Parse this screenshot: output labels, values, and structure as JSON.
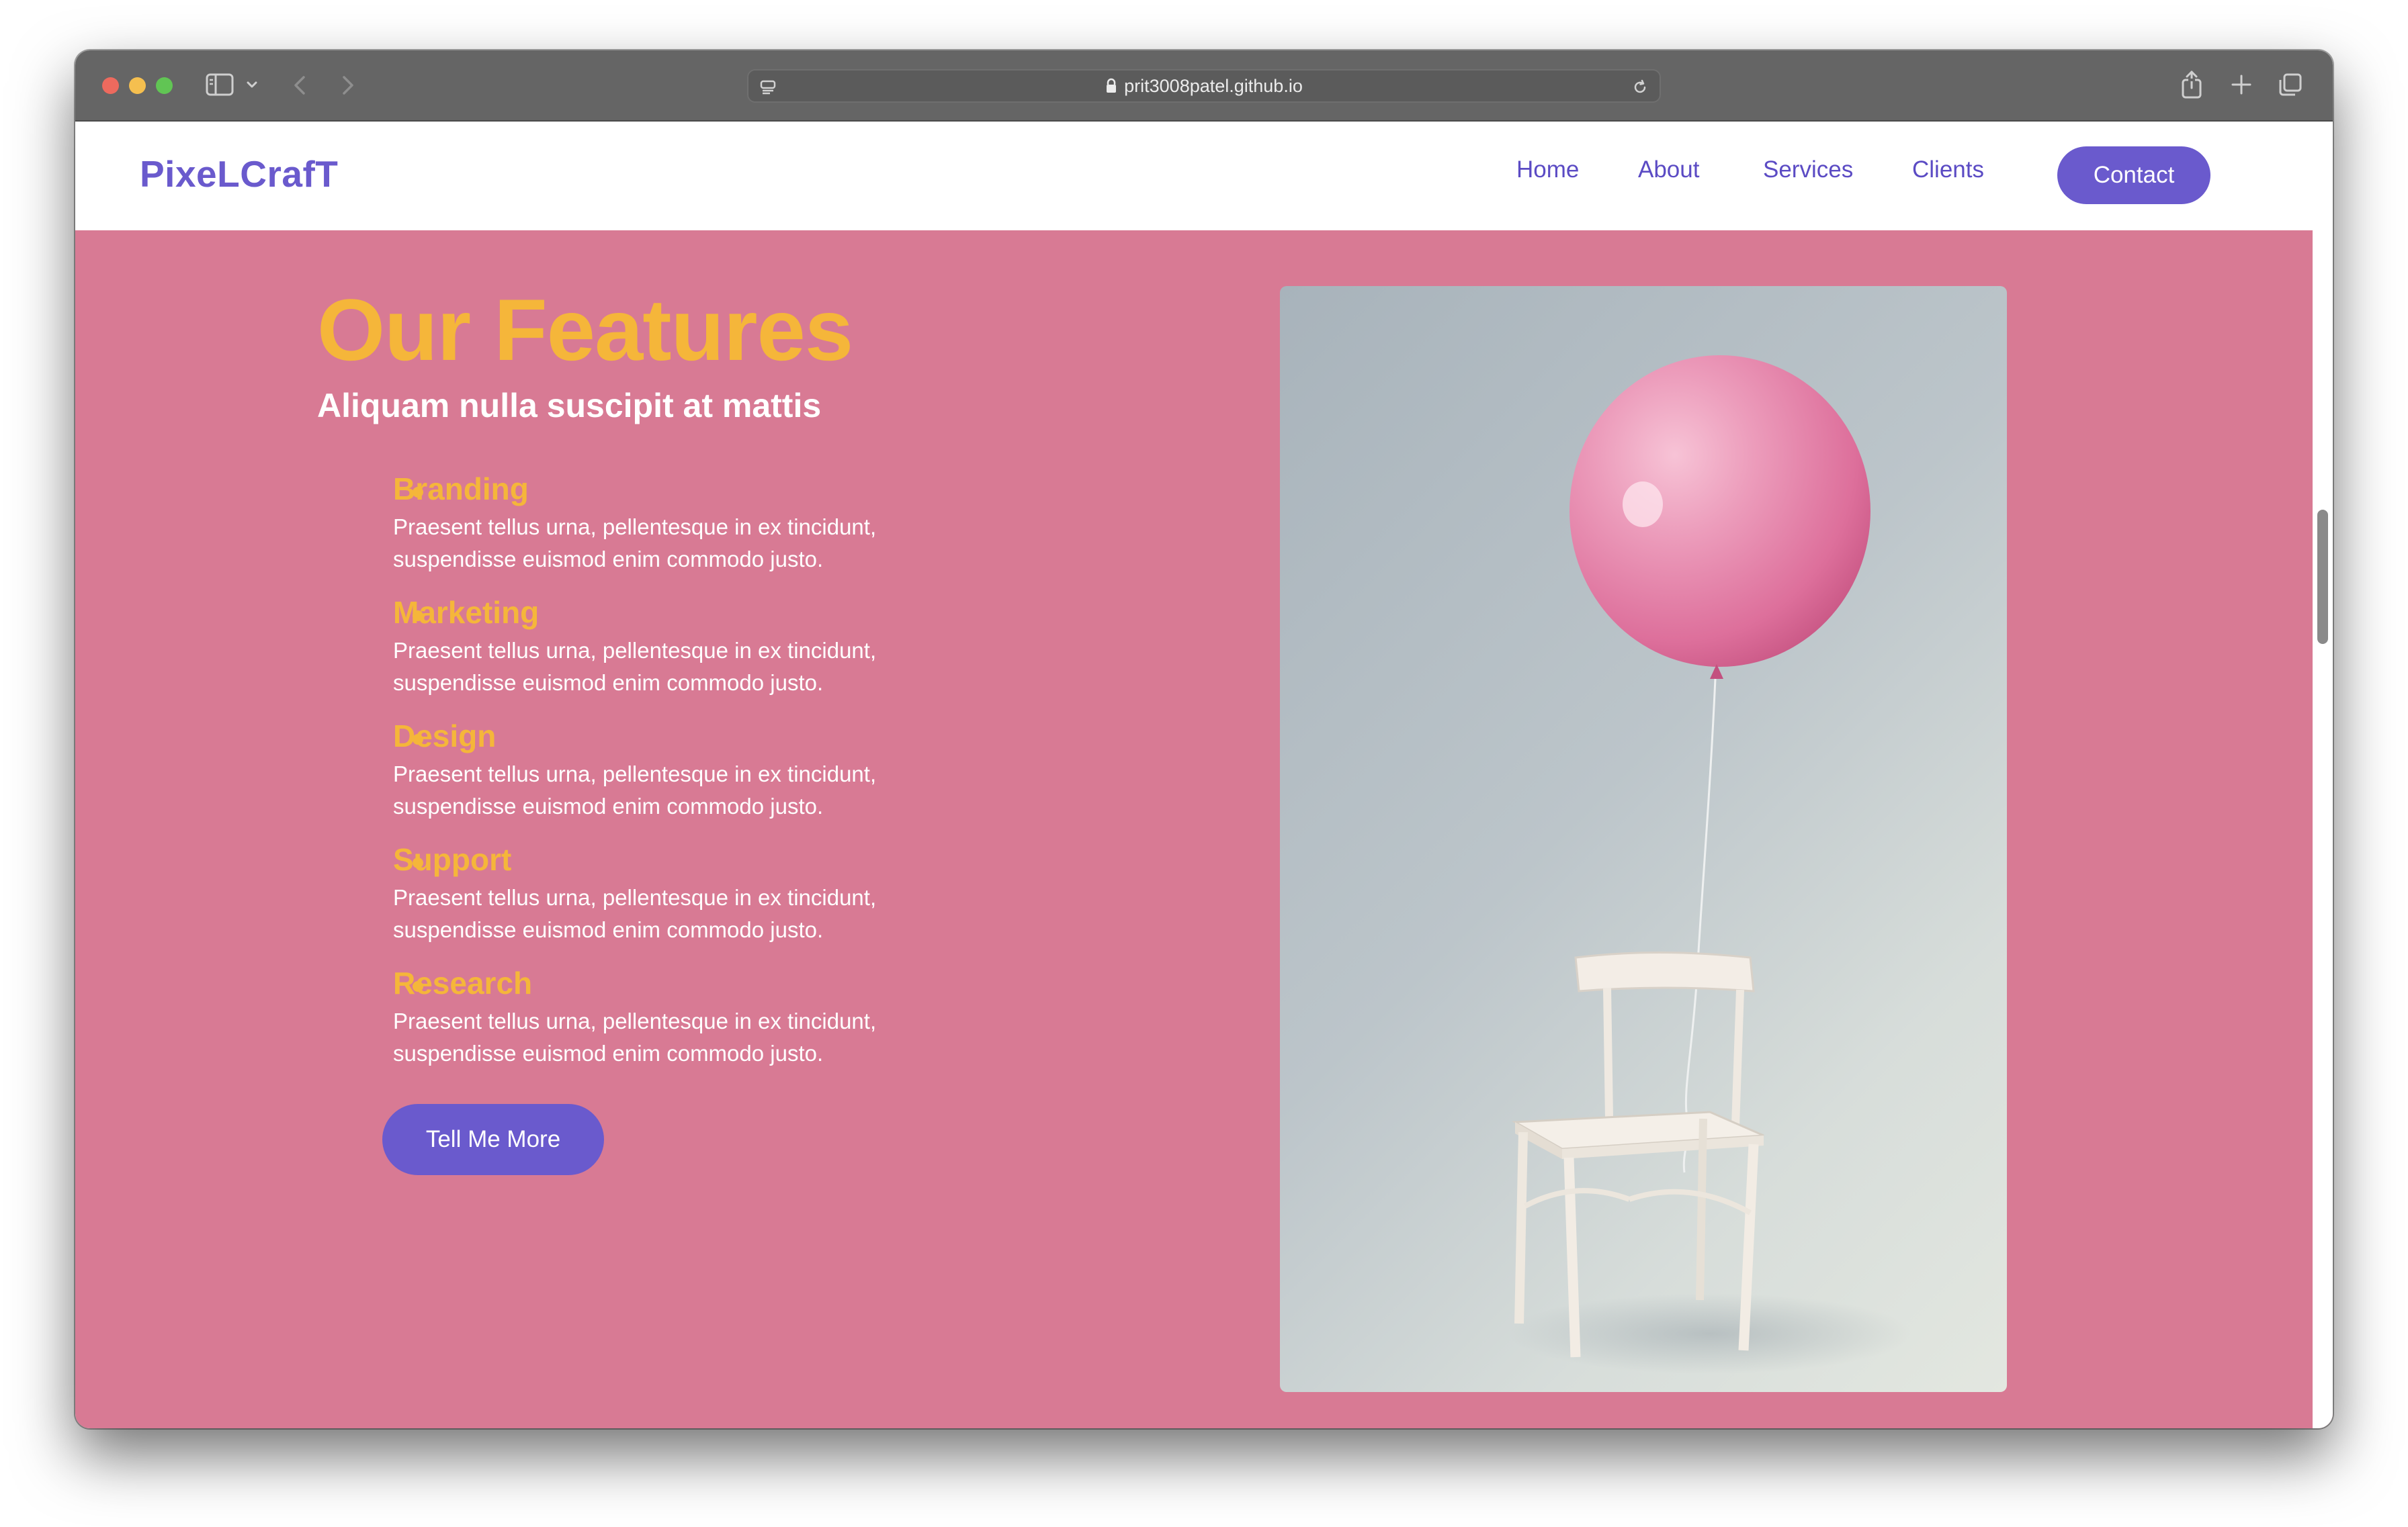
{
  "browser": {
    "url": "prit3008patel.github.io"
  },
  "site": {
    "logo": "PixeLCrafT",
    "nav": {
      "home": "Home",
      "about": "About",
      "services": "Services",
      "clients": "Clients",
      "contact": "Contact"
    }
  },
  "features": {
    "title": "Our Features",
    "subtitle": "Aliquam nulla suscipit at mattis",
    "items": [
      {
        "title": "Branding",
        "desc_line1": "Praesent tellus urna, pellentesque in ex tincidunt,",
        "desc_line2": "suspendisse euismod enim commodo justo."
      },
      {
        "title": "Marketing",
        "desc_line1": "Praesent tellus urna, pellentesque in ex tincidunt,",
        "desc_line2": "suspendisse euismod enim commodo justo."
      },
      {
        "title": "Design",
        "desc_line1": "Praesent tellus urna, pellentesque in ex tincidunt,",
        "desc_line2": "suspendisse euismod enim commodo justo."
      },
      {
        "title": "Support",
        "desc_line1": "Praesent tellus urna, pellentesque in ex tincidunt,",
        "desc_line2": "suspendisse euismod enim commodo justo."
      },
      {
        "title": "Research",
        "desc_line1": "Praesent tellus urna, pellentesque in ex tincidunt,",
        "desc_line2": "suspendisse euismod enim commodo justo."
      }
    ],
    "button_label": "Tell Me More"
  },
  "colors": {
    "page_background": "#d87a94",
    "accent_purple": "#6a5acd",
    "accent_yellow": "#f5b63a"
  },
  "icons": [
    "sidebar-icon",
    "chevron-down-icon",
    "back-arrow-icon",
    "forward-arrow-icon",
    "page-menu-icon",
    "lock-icon",
    "reload-icon",
    "share-icon",
    "new-tab-icon",
    "tab-overview-icon"
  ]
}
